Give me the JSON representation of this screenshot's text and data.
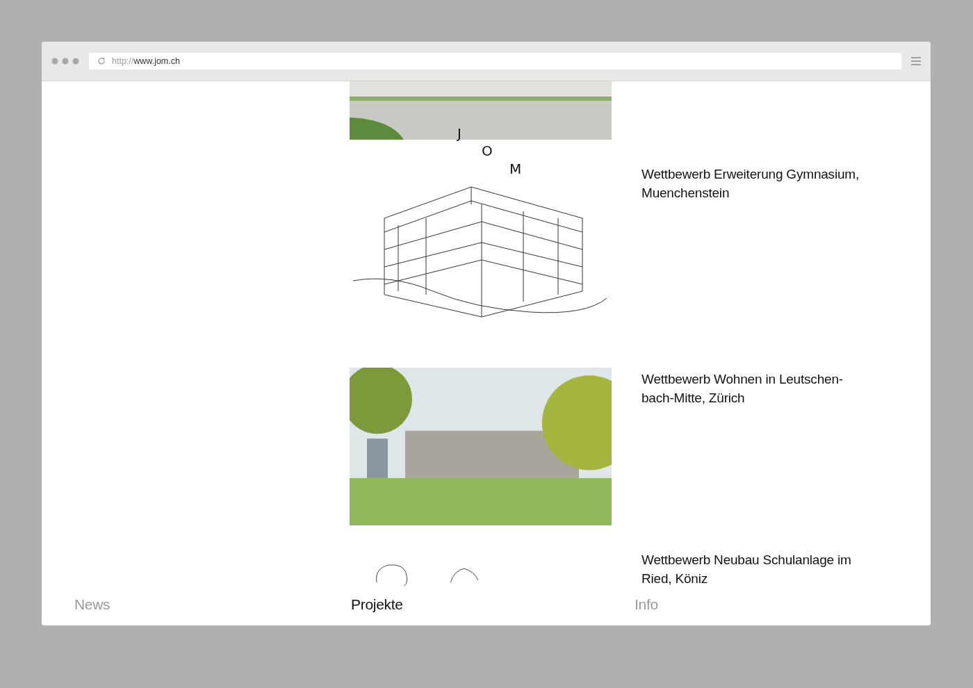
{
  "browser": {
    "url_protocol": "http://",
    "url_host": "www.jom.ch"
  },
  "logo": {
    "letters": [
      "J",
      "O",
      "M"
    ]
  },
  "projects": [
    {
      "kind": "photo"
    },
    {
      "kind": "drawing",
      "title": "Wettbewerb Erweiterung Gymnasium, Muenchenstein"
    },
    {
      "kind": "photo",
      "title": "Wettbewerb Wohnen in Leutschen-bach-Mitte, Zürich"
    },
    {
      "kind": "sketch",
      "title": "Wettbewerb Neubau Schulanlage im Ried, Köniz"
    }
  ],
  "nav": [
    {
      "label": "News",
      "selected": false
    },
    {
      "label": "Projekte",
      "selected": true
    },
    {
      "label": "Info",
      "selected": false
    }
  ]
}
